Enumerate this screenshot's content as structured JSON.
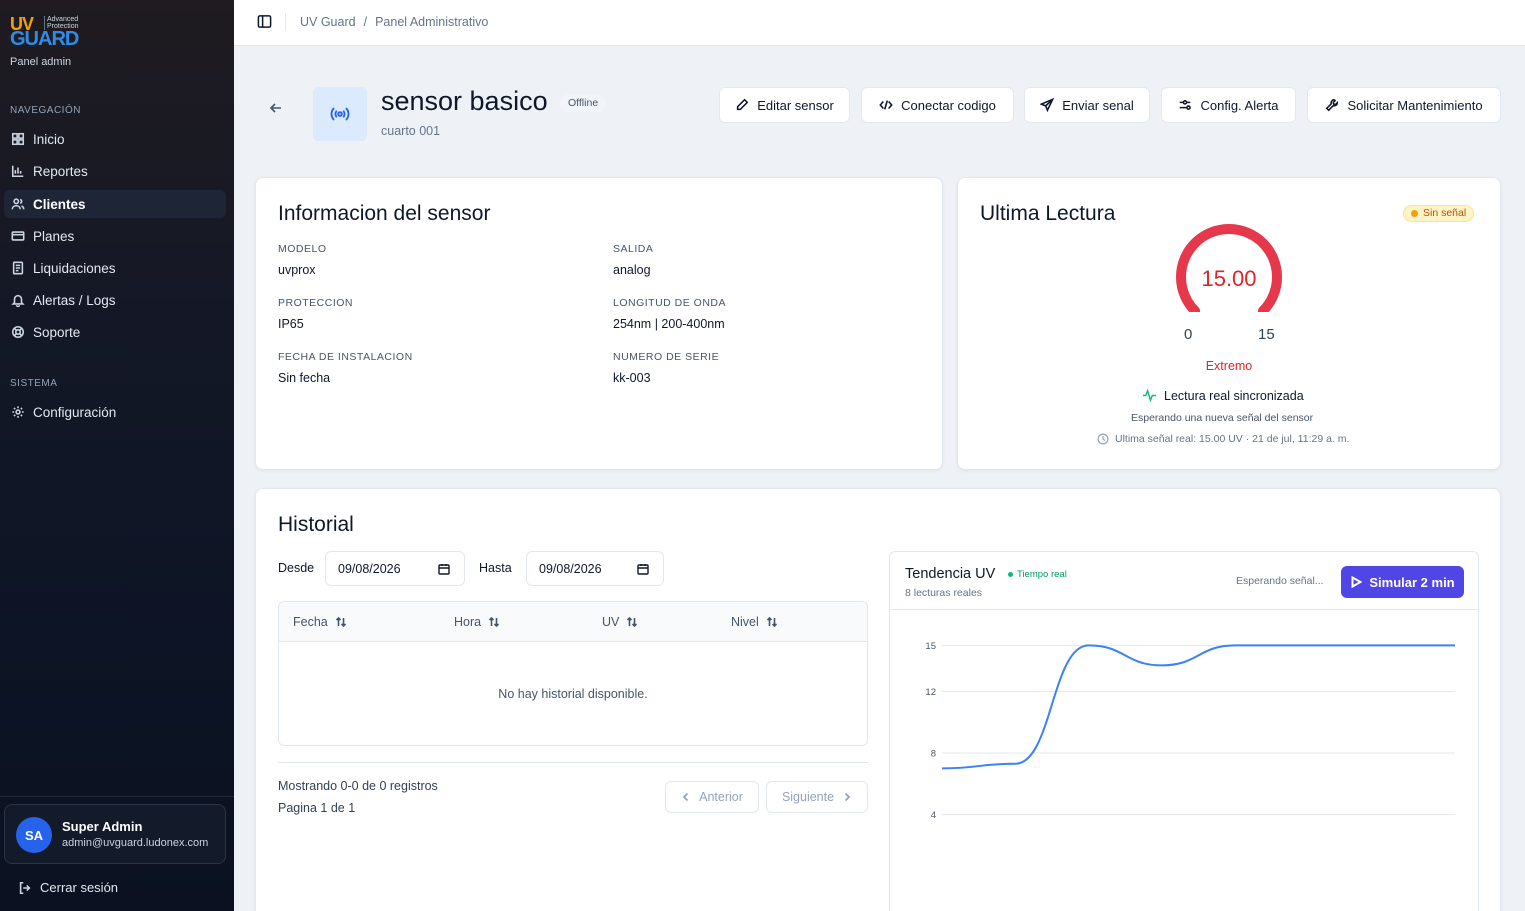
{
  "brand": {
    "logo_uv": "UV",
    "logo_advanced": "Advanced",
    "logo_protection": "Protection",
    "logo_guard": "GUARD",
    "subtitle": "Panel admin"
  },
  "sidebar": {
    "nav_section": "NAVEGACIÓN",
    "items": [
      {
        "label": "Inicio",
        "icon": "grid-icon"
      },
      {
        "label": "Reportes",
        "icon": "bar-chart-icon"
      },
      {
        "label": "Clientes",
        "icon": "users-icon",
        "active": true
      },
      {
        "label": "Planes",
        "icon": "card-icon"
      },
      {
        "label": "Liquidaciones",
        "icon": "receipt-icon"
      },
      {
        "label": "Alertas / Logs",
        "icon": "bell-icon"
      },
      {
        "label": "Soporte",
        "icon": "lifebuoy-icon"
      }
    ],
    "system_section": "SISTEMA",
    "system_items": [
      {
        "label": "Configuración",
        "icon": "gear-icon"
      }
    ],
    "user": {
      "initials": "SA",
      "name": "Super Admin",
      "email": "admin@uvguard.ludonex.com"
    },
    "logout_label": "Cerrar sesión"
  },
  "topbar": {
    "breadcrumb": [
      "UV Guard",
      "/",
      "Panel Administrativo"
    ]
  },
  "header": {
    "title": "sensor basico",
    "status": "Offline",
    "room": "cuarto 001",
    "actions": [
      "Editar sensor",
      "Conectar codigo",
      "Enviar senal",
      "Config. Alerta",
      "Solicitar Mantenimiento"
    ]
  },
  "info": {
    "title": "Informacion del sensor",
    "fields": [
      {
        "label": "MODELO",
        "value": "uvprox"
      },
      {
        "label": "SALIDA",
        "value": "analog"
      },
      {
        "label": "PROTECCION",
        "value": "IP65"
      },
      {
        "label": "LONGITUD DE ONDA",
        "value": "254nm | 200-400nm"
      },
      {
        "label": "FECHA DE INSTALACION",
        "value": "Sin fecha"
      },
      {
        "label": "NUMERO DE SERIE",
        "value": "kk-003"
      }
    ]
  },
  "reading": {
    "title": "Ultima Lectura",
    "badge": "Sin señal",
    "value": "15.00",
    "value_num": 15,
    "min": "0",
    "max": "15",
    "level": "Extremo",
    "sync": "Lectura real sincronizada",
    "waiting": "Esperando una nueva señal del sensor",
    "last": "Ultima señal real: 15.00 UV · 21 de jul, 11:29 a. m.",
    "colors": {
      "gauge": "#e5384a",
      "level": "#dc2626"
    }
  },
  "history": {
    "title": "Historial",
    "from_label": "Desde",
    "from_value": "09/08/2026",
    "to_label": "Hasta",
    "to_value": "09/08/2026",
    "columns": [
      "Fecha",
      "Hora",
      "UV",
      "Nivel"
    ],
    "empty": "No hay historial disponible.",
    "showing": "Mostrando 0-0 de 0 registros",
    "page": "Pagina 1 de 1",
    "prev": "Anterior",
    "next": "Siguiente"
  },
  "trend": {
    "title": "Tendencia UV",
    "live": "Tiempo real",
    "count": "8 lecturas reales",
    "waiting": "Esperando señal...",
    "simulate": "Simular 2 min"
  },
  "chart_data": {
    "type": "line",
    "x": [
      0,
      1,
      2,
      3,
      4,
      5,
      6,
      7
    ],
    "values": [
      7.0,
      7.3,
      15.0,
      13.7,
      15.0,
      15.0,
      15.0,
      15.0
    ],
    "yticks": [
      4,
      8,
      12,
      15
    ],
    "ylim": [
      2,
      16
    ],
    "grid": true,
    "color": "#3b82f6"
  }
}
